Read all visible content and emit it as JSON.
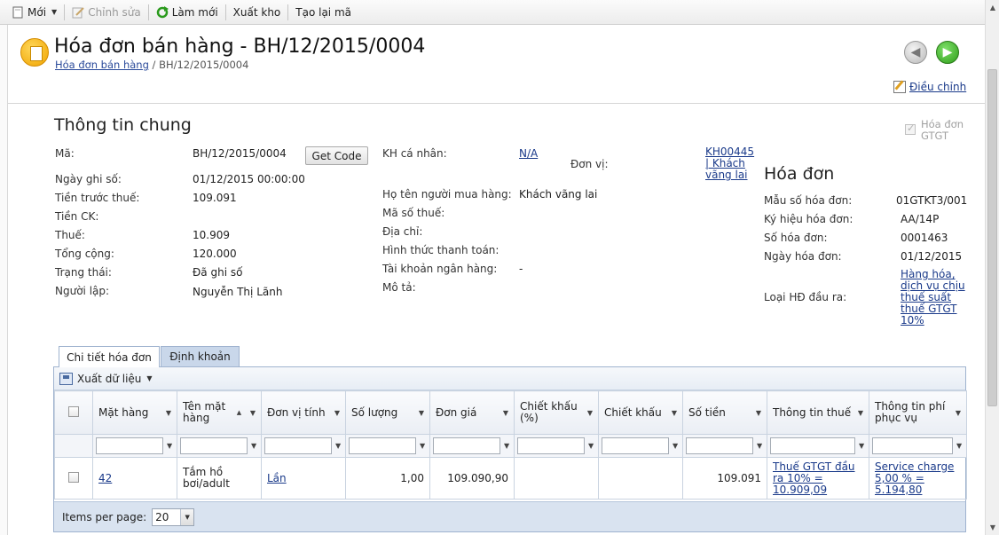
{
  "toolbar": {
    "new_label": "Mới",
    "edit_label": "Chỉnh sửa",
    "refresh_label": "Làm mới",
    "export_stock_label": "Xuất kho",
    "regen_code_label": "Tạo lại mã"
  },
  "header": {
    "title": "Hóa đơn bán hàng - BH/12/2015/0004",
    "breadcrumb_link": "Hóa đơn bán hàng",
    "breadcrumb_sep": " / ",
    "breadcrumb_current": "BH/12/2015/0004",
    "adjust_label": "Điều chỉnh"
  },
  "general": {
    "title": "Thông tin chung",
    "code_label": "Mã:",
    "code_value": "BH/12/2015/0004",
    "get_code_label": "Get Code",
    "post_date_label": "Ngày ghi số:",
    "post_date_value": "01/12/2015 00:00:00",
    "pretax_label": "Tiền trước thuế:",
    "pretax_value": "109.091",
    "discount_label": "Tiền CK:",
    "discount_value": "",
    "tax_label": "Thuế:",
    "tax_value": "10.909",
    "total_label": "Tổng cộng:",
    "total_value": "120.000",
    "status_label": "Trạng thái:",
    "status_value": "Đã ghi số",
    "creator_label": "Người lập:",
    "creator_value": "Nguyễn Thị Lãnh",
    "customer_label": "KH cá nhân:",
    "customer_value": "N/A",
    "unit_label": "Đơn vị:",
    "unit_value_1": "KH00445",
    "unit_value_2": "| Khách",
    "unit_value_3": "vãng lai",
    "buyer_label": "Họ tên người mua hàng:",
    "buyer_value": "Khách vãng lai",
    "taxcode_label": "Mã số thuế:",
    "address_label": "Địa chỉ:",
    "payment_label": "Hình thức thanh toán:",
    "bank_label": "Tài khoản ngân hàng:",
    "bank_value": "-",
    "desc_label": "Mô tả:",
    "gtgt_label": "Hóa đơn GTGT"
  },
  "invoice": {
    "title": "Hóa đơn",
    "form_label": "Mẫu số hóa đơn:",
    "form_value": "01GTKT3/001",
    "symbol_label": "Ký hiệu hóa đơn:",
    "symbol_value": "AA/14P",
    "number_label": "Số hóa đơn:",
    "number_value": "0001463",
    "date_label": "Ngày hóa đơn:",
    "date_value": "01/12/2015",
    "type_label": "Loại HĐ đầu ra:",
    "type_value_lines": [
      "Hàng hóa,",
      "dịch vụ chịu",
      "thuế suất",
      "thuế GTGT",
      "10%"
    ]
  },
  "tabs": {
    "details": "Chi tiết hóa đơn",
    "accounting": "Định khoản"
  },
  "grid": {
    "export_label": "Xuất dữ liệu",
    "columns": [
      "Mặt hàng",
      "Tên mặt hàng",
      "Đơn vị tính",
      "Số lượng",
      "Đơn giá",
      "Chiết khấu (%)",
      "Chiết khấu",
      "Số tiền",
      "Thông tin thuế",
      "Thông tin phí phục vụ"
    ],
    "row": {
      "item": "42",
      "name": "Tắm hồ bơi/adult",
      "unit": "Lần",
      "qty": "1,00",
      "price": "109.090,90",
      "discount_pct": "",
      "discount": "",
      "amount": "109.091",
      "tax_info": "Thuế GTGT đầu ra 10% = 10.909,09",
      "service_info": "Service charge 5,00 % = 5.194,80"
    },
    "items_per_page_label": "Items per page:",
    "items_per_page_value": "20"
  }
}
